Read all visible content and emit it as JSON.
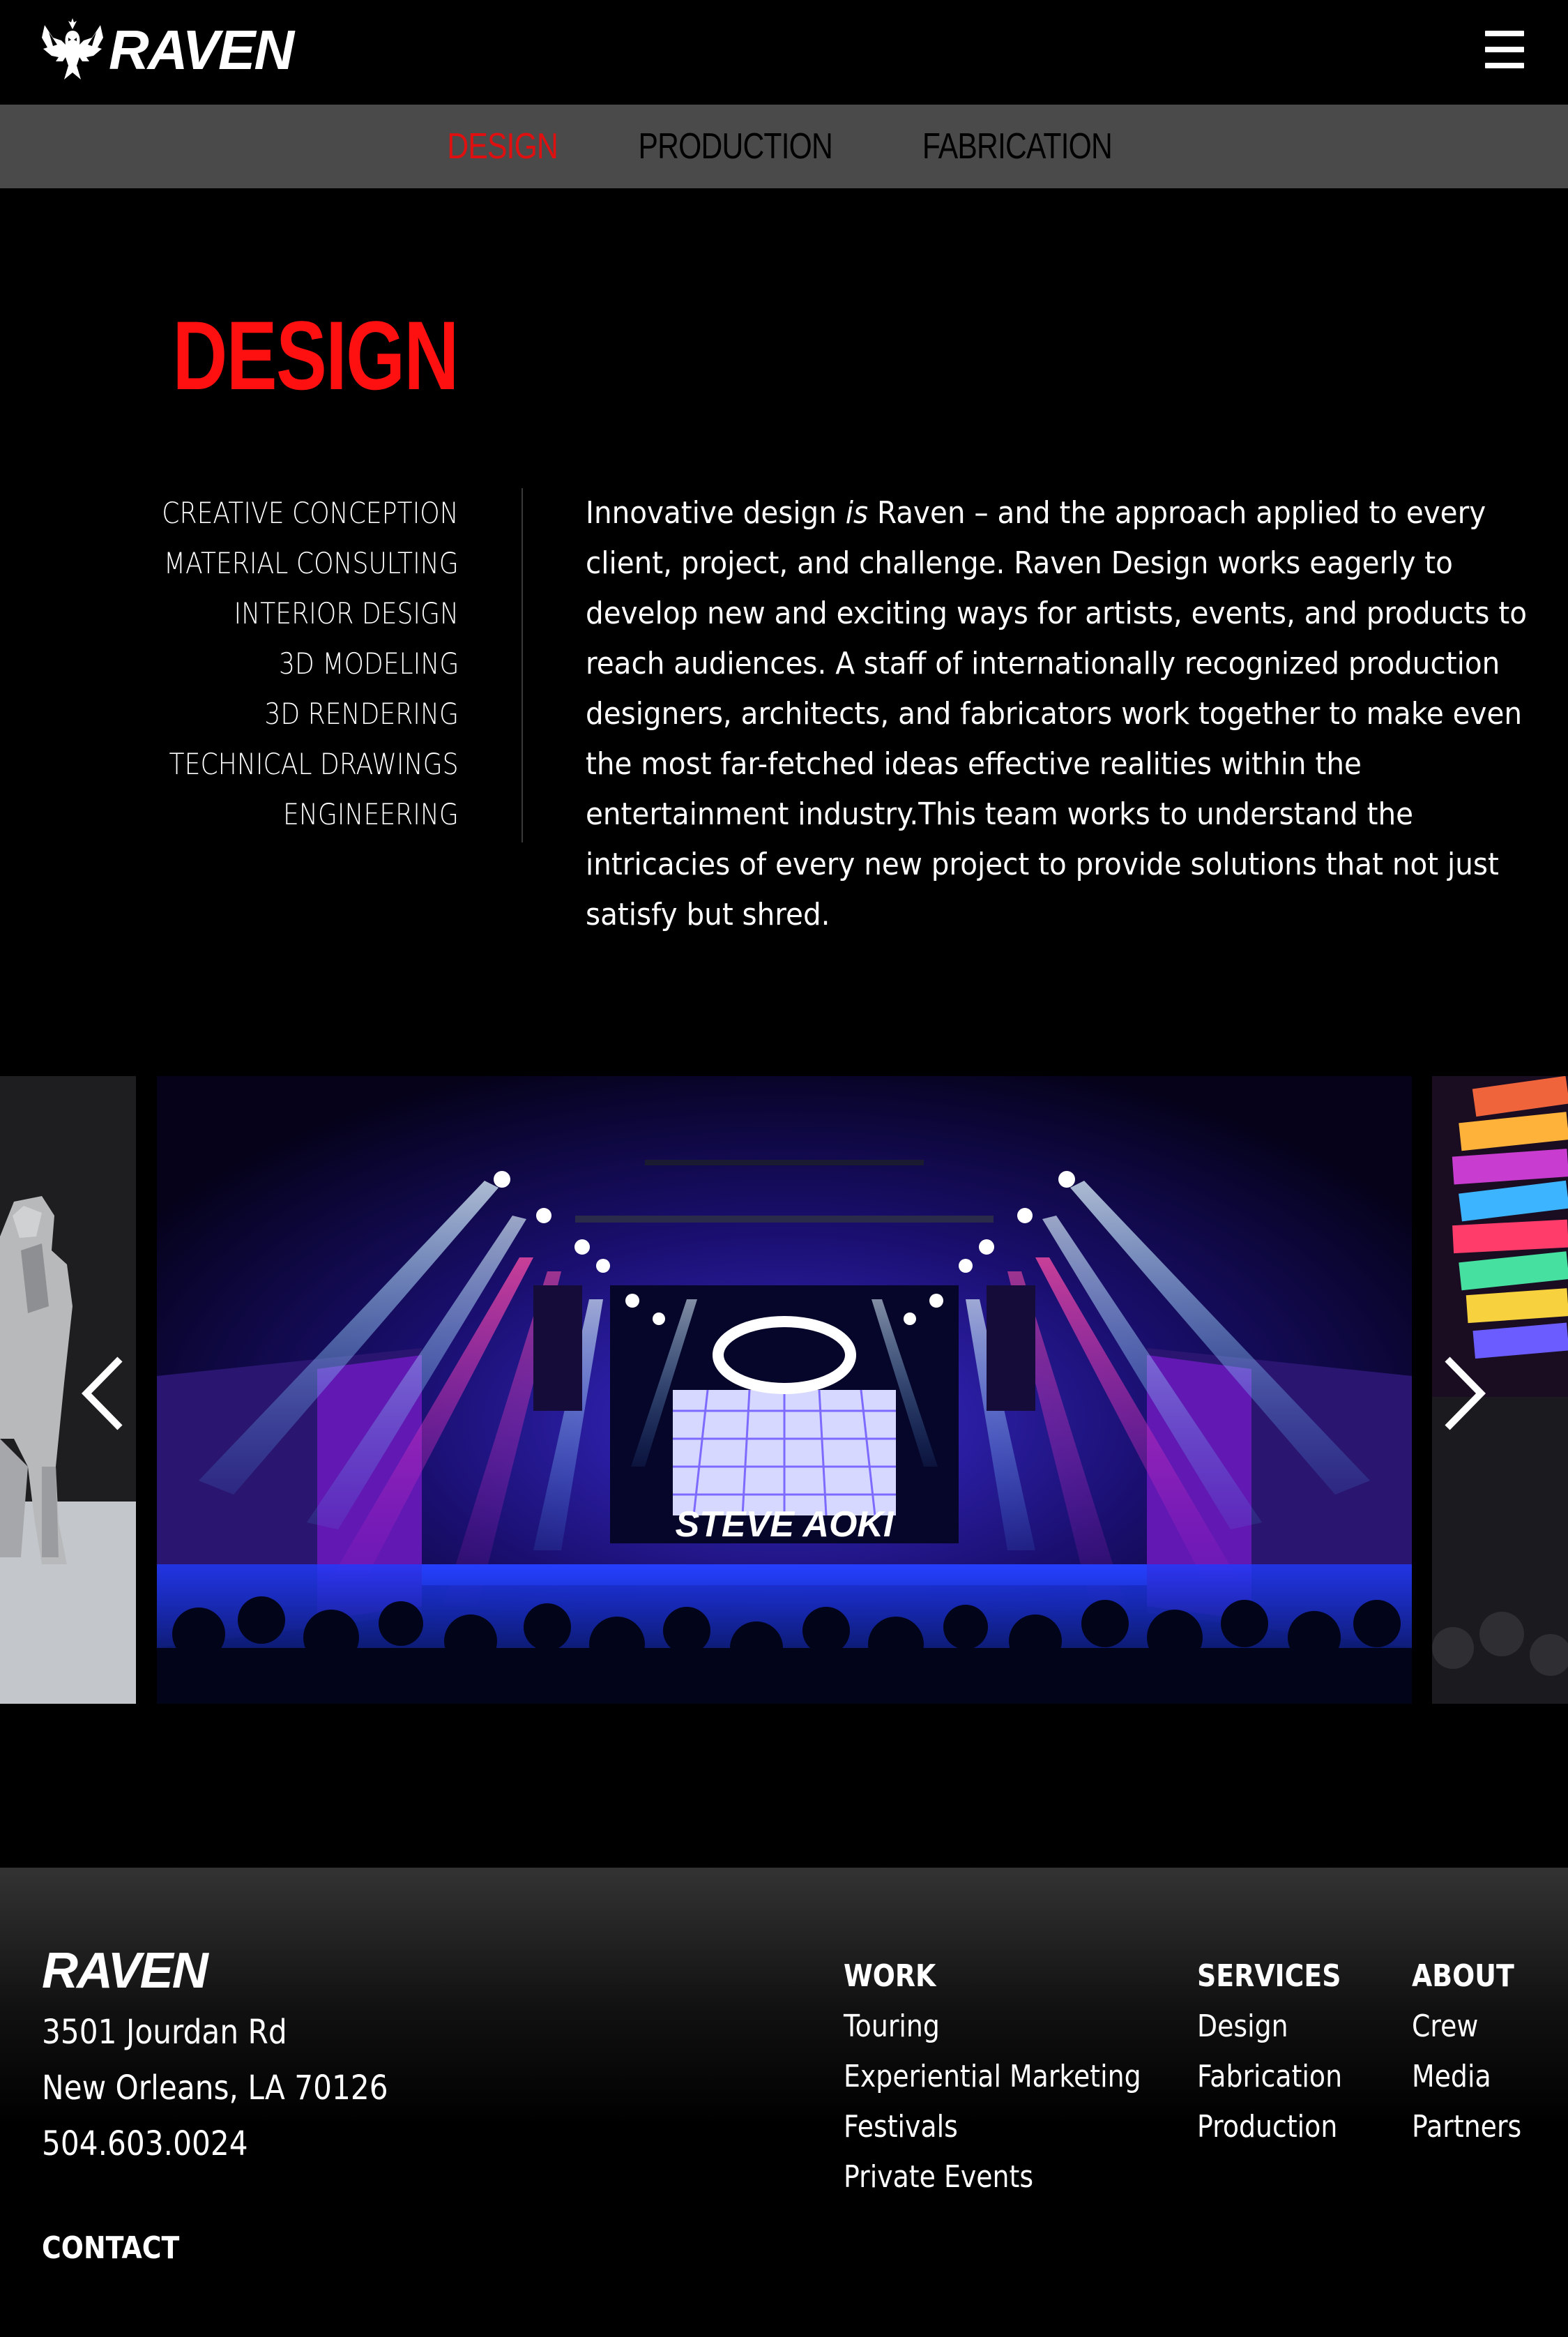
{
  "brand": {
    "name": "RAVEN",
    "icon": "raven-bird-icon"
  },
  "header": {
    "menu_icon": "hamburger-icon"
  },
  "subnav": {
    "items": [
      {
        "label": "DESIGN",
        "active": true
      },
      {
        "label": "PRODUCTION",
        "active": false
      },
      {
        "label": "FABRICATION",
        "active": false
      }
    ],
    "active_color": "#e01010"
  },
  "design": {
    "title": "DESIGN",
    "services": [
      "CREATIVE CONCEPTION",
      "MATERIAL CONSULTING",
      "INTERIOR DESIGN",
      "3D MODELING",
      "3D RENDERING",
      "TECHNICAL DRAWINGS",
      "ENGINEERING"
    ],
    "intro_before": "Innovative design ",
    "intro_em": "is",
    "intro_after": " Raven – and the approach applied to every client, project, and challenge. Raven Design works eagerly to develop new and exciting ways for artists, events, and products to reach audiences. A staff of internationally recognized production designers, architects, and fabricators work together to make even the most far-fetched ideas effective realities within the entertainment industry.This team works to understand the intricacies of every new project to provide solutions that not just satisfy but shred."
  },
  "carousel": {
    "main_slide_text": "STEVE AOKI",
    "prev_icon": "chevron-left-icon",
    "next_icon": "chevron-right-icon"
  },
  "footer": {
    "logo": "RAVEN",
    "address": [
      "3501 Jourdan Rd",
      "New Orleans, LA 70126",
      "504.603.0024"
    ],
    "contact": "CONTACT",
    "columns": {
      "work": {
        "heading": "WORK",
        "links": [
          "Touring",
          "Experiential Marketing",
          "Festivals",
          "Private Events"
        ]
      },
      "services": {
        "heading": "SERVICES",
        "links": [
          "Design",
          "Fabrication",
          "Production"
        ]
      },
      "about": {
        "heading": "ABOUT",
        "links": [
          "Crew",
          "Media",
          "Partners"
        ]
      }
    }
  }
}
